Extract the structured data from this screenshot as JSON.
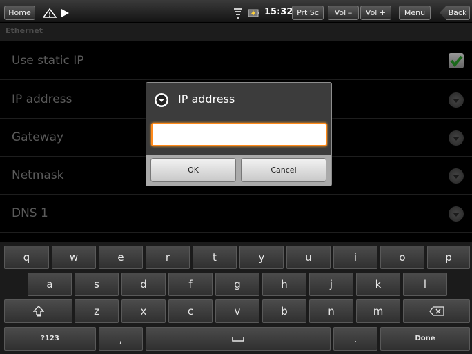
{
  "statusbar": {
    "home_label": "Home",
    "warning_icon": "warning-icon",
    "play_icon": "play-icon",
    "wifi_icon": "wifi-icon",
    "battery_icon": "battery-icon",
    "clock": "15:32",
    "prtsc_label": "Prt Sc",
    "voldown_label": "Vol –",
    "volup_label": "Vol +",
    "menu_label": "Menu",
    "back_label": "Back"
  },
  "title": "Ethernet",
  "preferences": [
    {
      "label": "Use static IP",
      "widget": "checkbox",
      "checked": true
    },
    {
      "label": "IP address",
      "widget": "arrow"
    },
    {
      "label": "Gateway",
      "widget": "arrow"
    },
    {
      "label": "Netmask",
      "widget": "arrow"
    },
    {
      "label": "DNS 1",
      "widget": "arrow"
    }
  ],
  "dialog": {
    "title": "IP address",
    "input_value": "",
    "ok_label": "OK",
    "cancel_label": "Cancel",
    "accent": "#ff8a1a"
  },
  "keyboard": {
    "row1": [
      "q",
      "w",
      "e",
      "r",
      "t",
      "y",
      "u",
      "i",
      "o",
      "p"
    ],
    "row2": [
      "a",
      "s",
      "d",
      "f",
      "g",
      "h",
      "j",
      "k",
      "l"
    ],
    "row3": [
      "z",
      "x",
      "c",
      "v",
      "b",
      "n",
      "m"
    ],
    "symbols_label": "?123",
    "comma_label": ",",
    "period_label": ".",
    "done_label": "Done",
    "shift_icon": "shift-icon",
    "backspace_icon": "backspace-icon",
    "space_icon": "space-icon"
  }
}
